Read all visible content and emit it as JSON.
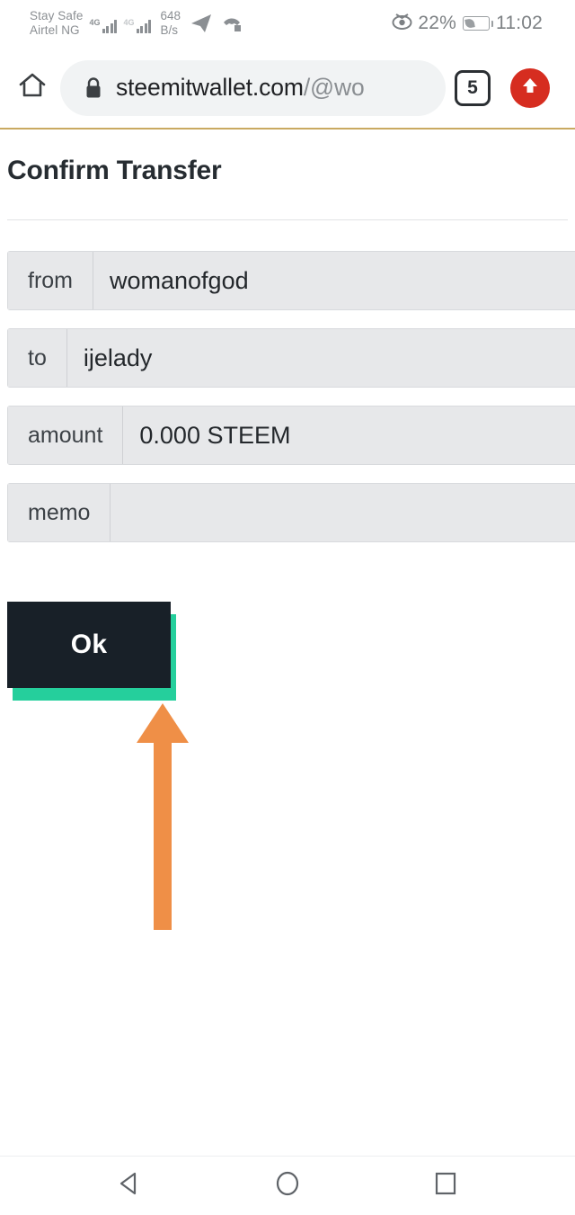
{
  "status_bar": {
    "carrier_line1": "Stay Safe",
    "carrier_line2": "Airtel NG",
    "sim1_network": "4G",
    "sim2_network": "4G",
    "data_speed_value": "648",
    "data_speed_unit": "B/s",
    "telegram_icon": "telegram-icon",
    "missed_call_icon": "missed-call-icon",
    "eye_icon": "eye-care-icon",
    "battery_percent": "22%",
    "battery_icon": "battery-icon",
    "time": "11:02"
  },
  "browser": {
    "home_icon": "home-icon",
    "lock_icon": "lock-icon",
    "url_domain": "steemitwallet.com",
    "url_path": "/@wo",
    "url_full": "steemitwallet.com/@wo",
    "tab_count": "5",
    "menu_icon": "upload-arrow-icon",
    "progress_color": "#c9a961"
  },
  "page": {
    "title": "Confirm Transfer",
    "fields": [
      {
        "label": "from",
        "value": "womanofgod"
      },
      {
        "label": "to",
        "value": "ijelady"
      },
      {
        "label": "amount",
        "value": "0.000 STEEM"
      },
      {
        "label": "memo",
        "value": ""
      }
    ],
    "ok_button": {
      "label": "Ok",
      "fill_color": "#182028",
      "shadow_color": "#25cf9c",
      "text_color": "#ffffff"
    },
    "annotation": {
      "type": "arrow",
      "direction": "up",
      "color": "#ef8f47",
      "points_at": "ok-button"
    }
  },
  "nav_bar": {
    "back_icon": "back-triangle-icon",
    "home_icon": "home-circle-icon",
    "recents_icon": "recents-square-icon"
  }
}
